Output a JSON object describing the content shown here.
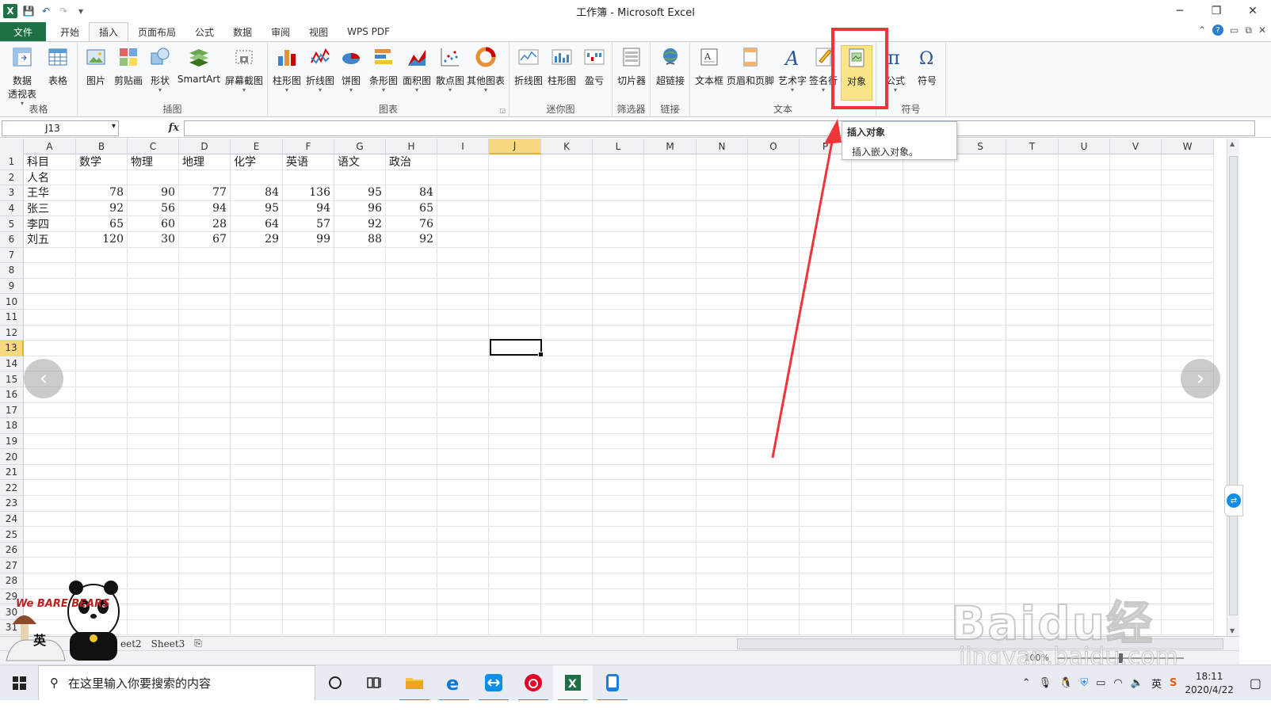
{
  "window": {
    "title": "工作簿 - Microsoft Excel",
    "controls": {
      "minimize": "─",
      "restore": "❐",
      "close": "✕"
    }
  },
  "qat": {
    "app_icon": "X",
    "save": "💾",
    "undo": "↶",
    "redo": "↷",
    "customize": "▾"
  },
  "tabs": [
    "文件",
    "开始",
    "插入",
    "页面布局",
    "公式",
    "数据",
    "审阅",
    "视图",
    "WPS PDF"
  ],
  "active_tab": "插入",
  "ribbon_groups": [
    {
      "name": "表格",
      "buttons": [
        "数据\n透视表",
        "表格"
      ]
    },
    {
      "name": "插图",
      "buttons": [
        "图片",
        "剪贴画",
        "形状",
        "SmartArt",
        "屏幕截图"
      ]
    },
    {
      "name": "图表",
      "buttons": [
        "柱形图",
        "折线图",
        "饼图",
        "条形图",
        "面积图",
        "散点图",
        "其他图表"
      ]
    },
    {
      "name": "迷你图",
      "buttons": [
        "折线图",
        "柱形图",
        "盈亏"
      ]
    },
    {
      "name": "筛选器",
      "buttons": [
        "切片器"
      ]
    },
    {
      "name": "链接",
      "buttons": [
        "超链接"
      ]
    },
    {
      "name": "文本",
      "buttons": [
        "文本框",
        "页眉和页脚",
        "艺术字",
        "签名行",
        "对象"
      ]
    },
    {
      "name": "符号",
      "buttons": [
        "公式",
        "符号"
      ]
    }
  ],
  "ribbon_labels": {
    "pivot_line1": "数据",
    "pivot_line2": "透视表",
    "table": "表格",
    "picture": "图片",
    "clipart": "剪贴画",
    "shapes": "形状",
    "smartart": "SmartArt",
    "screenshot": "屏幕截图",
    "column": "柱形图",
    "line": "折线图",
    "pie": "饼图",
    "bar": "条形图",
    "area": "面积图",
    "scatter": "散点图",
    "other": "其他图表",
    "spark_line": "折线图",
    "spark_column": "柱形图",
    "spark_winloss": "盈亏",
    "slicer": "切片器",
    "hyperlink": "超链接",
    "textbox": "文本框",
    "header_footer": "页眉和页脚",
    "wordart": "艺术字",
    "signature": "签名行",
    "object": "对象",
    "equation": "公式",
    "symbol": "符号"
  },
  "tooltip": {
    "title": "插入对象",
    "description": "插入嵌入对象。"
  },
  "formula_bar": {
    "name_box": "J13",
    "fx": "fx",
    "value": ""
  },
  "columns": [
    "A",
    "B",
    "C",
    "D",
    "E",
    "F",
    "G",
    "H",
    "I",
    "J",
    "K",
    "L",
    "M",
    "N",
    "O",
    "P",
    "Q",
    "R",
    "S",
    "T",
    "U",
    "V",
    "W"
  ],
  "active_column": "J",
  "active_row": 13,
  "cells": [
    [
      "科目",
      "数学",
      "物理",
      "地理",
      "化学",
      "英语",
      "语文",
      "政治"
    ],
    [
      "人名",
      "",
      "",
      "",
      "",
      "",
      "",
      ""
    ],
    [
      "王华",
      "78",
      "90",
      "77",
      "84",
      "136",
      "95",
      "84"
    ],
    [
      "张三",
      "92",
      "56",
      "94",
      "95",
      "94",
      "96",
      "65"
    ],
    [
      "李四",
      "65",
      "60",
      "28",
      "64",
      "57",
      "92",
      "76"
    ],
    [
      "刘五",
      "120",
      "30",
      "67",
      "29",
      "99",
      "88",
      "92"
    ]
  ],
  "visible_rows": 31,
  "sheet_tabs": [
    "eet2",
    "Sheet3"
  ],
  "status": {
    "zoom": "100%"
  },
  "mascot": {
    "brand": "We BARE BEARS",
    "badge": "英"
  },
  "watermark": {
    "main": "Baidu经验",
    "sub": "jingyan.baidu.com"
  },
  "taskbar": {
    "search_placeholder": "在这里输入你要搜索的内容",
    "time": "18:11",
    "date": "2020/4/22",
    "ime": "英"
  },
  "colors": {
    "excel_green": "#1e7145",
    "highlight_red": "#f0353a",
    "active_header": "#f9d77e"
  }
}
